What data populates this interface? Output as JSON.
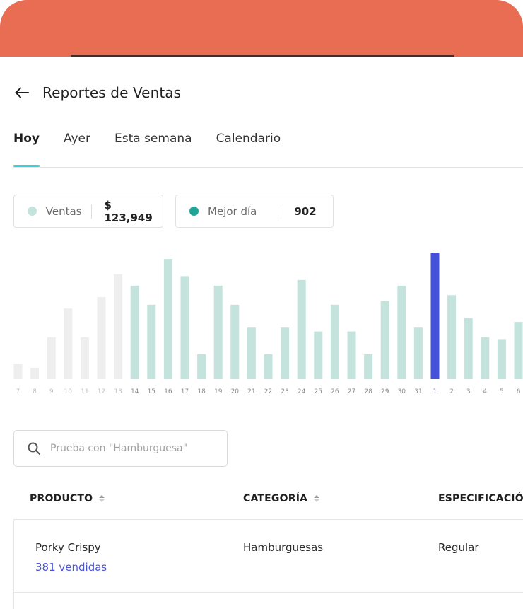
{
  "colors": {
    "accent_header": "#e96d52",
    "tab_indicator": "#2fd3dc",
    "bar_light": "#c3e3dc",
    "bar_faded": "#eeeeee",
    "bar_selected": "#4452d9",
    "ventas_dot": "#c3e3dc",
    "mejor_dot": "#1ea595",
    "link": "#4a57d8"
  },
  "header": {
    "back_icon": "arrow-left-icon",
    "title": "Reportes de Ventas"
  },
  "tabs": [
    {
      "label": "Hoy",
      "active": true
    },
    {
      "label": "Ayer",
      "active": false
    },
    {
      "label": "Esta semana",
      "active": false
    },
    {
      "label": "Calendario",
      "active": false
    }
  ],
  "stats": {
    "ventas": {
      "label": "Ventas",
      "value": "$ 123,949"
    },
    "mejor": {
      "label": "Mejor día",
      "value": "902"
    }
  },
  "chart_data": {
    "type": "bar",
    "categories": [
      "7",
      "8",
      "9",
      "10",
      "11",
      "12",
      "13",
      "14",
      "15",
      "16",
      "17",
      "18",
      "19",
      "20",
      "21",
      "22",
      "23",
      "24",
      "25",
      "26",
      "27",
      "28",
      "29",
      "30",
      "31",
      "1",
      "2",
      "3",
      "4",
      "5",
      "6"
    ],
    "values": [
      8,
      6,
      22,
      37,
      22,
      43,
      55,
      49,
      39,
      63,
      54,
      13,
      49,
      39,
      27,
      13,
      27,
      52,
      25,
      39,
      25,
      13,
      41,
      49,
      27,
      66,
      44,
      32,
      22,
      21,
      30
    ],
    "faded": [
      true,
      true,
      true,
      true,
      true,
      true,
      true,
      false,
      false,
      false,
      false,
      false,
      false,
      false,
      false,
      false,
      false,
      false,
      false,
      false,
      false,
      false,
      false,
      false,
      false,
      false,
      false,
      false,
      false,
      false,
      false
    ],
    "selected_index": 25,
    "title": "",
    "xlabel": "",
    "ylabel": "",
    "ylim": [
      0,
      66
    ]
  },
  "search": {
    "icon": "search-icon",
    "placeholder": "Prueba con \"Hamburguesa\""
  },
  "table": {
    "columns": [
      {
        "label": "PRODUCTO",
        "sortable": true
      },
      {
        "label": "CATEGORÍA",
        "sortable": true
      },
      {
        "label": "ESPECIFICACIÓN",
        "sortable": false
      }
    ],
    "rows": [
      {
        "producto": "Porky Crispy",
        "vendidas": "381 vendidas",
        "categoria": "Hamburguesas",
        "especificacion": "Regular"
      }
    ]
  }
}
